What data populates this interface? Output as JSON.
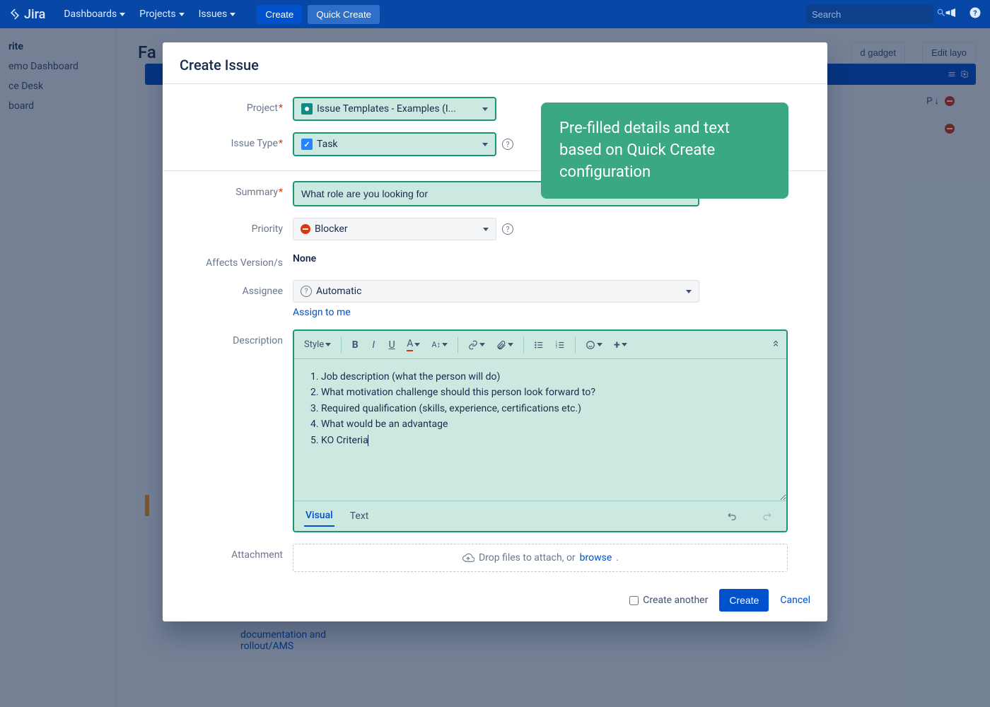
{
  "topnav": {
    "logo": "Jira",
    "items": [
      "Dashboards",
      "Projects",
      "Issues"
    ],
    "create": "Create",
    "quick_create": "Quick Create",
    "search_placeholder": "Search"
  },
  "sidebar": {
    "items": [
      "rite",
      "emo Dashboard",
      "ce Desk",
      "board"
    ]
  },
  "bg": {
    "title": "Fa",
    "add_gadget": "d gadget",
    "edit_layout": "Edit layo",
    "blue_label": "P ↓",
    "link_text": "documentation and rollout/AMS"
  },
  "dialog": {
    "title": "Create Issue",
    "fields": {
      "project": {
        "label": "Project",
        "value": "Issue Templates - Examples (I..."
      },
      "issue_type": {
        "label": "Issue Type",
        "value": "Task"
      },
      "summary": {
        "label": "Summary",
        "value": "What role are you looking for"
      },
      "priority": {
        "label": "Priority",
        "value": "Blocker"
      },
      "affects": {
        "label": "Affects Version/s",
        "value": "None"
      },
      "assignee": {
        "label": "Assignee",
        "value": "Automatic",
        "assign_me": "Assign to me"
      },
      "description": {
        "label": "Description"
      },
      "attachment": {
        "label": "Attachment",
        "hint_pre": "Drop files to attach, or ",
        "hint_link": "browse"
      }
    },
    "editor": {
      "style": "Style",
      "tabs": {
        "visual": "Visual",
        "text": "Text"
      },
      "lines": [
        "Job description (what the person will do)",
        "What motivation challenge should this person look forward to?",
        "Required qualification (skills, experience, certifications etc.)",
        "What would be an advantage",
        "KO Criteria"
      ]
    },
    "footer": {
      "create_another": "Create another",
      "create": "Create",
      "cancel": "Cancel"
    }
  },
  "callout": "Pre-filled details and text based on Quick Create configuration"
}
